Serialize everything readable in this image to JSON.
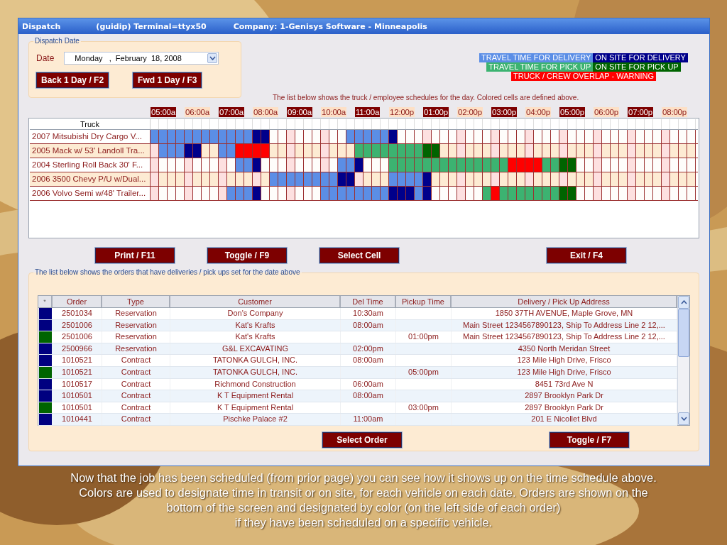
{
  "window": {
    "title_parts": [
      "Dispatch",
      "(guidip) Terminal=ttyx50",
      "Company:  1-Genisys Software - Minneapolis"
    ]
  },
  "dispatch_date": {
    "legend": "Dispatch Date",
    "label": "Date",
    "value": "Monday   ,  February  18, 2008"
  },
  "date_buttons": [
    "Back 1 Day / F2",
    "Fwd 1 Day / F3"
  ],
  "legend": [
    [
      {
        "label": "TRAVEL TIME FOR DELIVERY",
        "kind": "td"
      },
      {
        "label": "ON SITE FOR DELIVERY",
        "kind": "sd"
      }
    ],
    [
      {
        "label": "TRAVEL TIME FOR PICK UP",
        "kind": "tp"
      },
      {
        "label": "ON SITE FOR PICK UP",
        "kind": "sp"
      }
    ],
    [
      {
        "label": "TRUCK / CREW OVERLAP - WARNING",
        "kind": "ov"
      }
    ]
  ],
  "schedule_note": "The list below shows the truck / employee schedules for the day. Colored cells are defined above.",
  "time_labels": [
    "05:00a",
    "06:00a",
    "07:00a",
    "08:00a",
    "09:00a",
    "10:00a",
    "11:00a",
    "12:00p",
    "01:00p",
    "02:00p",
    "03:00p",
    "04:00p",
    "05:00p",
    "06:00p",
    "07:00p",
    "08:00p"
  ],
  "truck_column": "Truck",
  "trucks": [
    {
      "name": "2007 Mitsubishi Dry Cargo V...",
      "slots": [
        {
          "kind": "td"
        },
        {
          "kind": "td"
        },
        {
          "kind": "td"
        },
        {
          "kind": "td"
        },
        {
          "kind": "td"
        },
        {
          "kind": "td"
        },
        {
          "kind": "td"
        },
        {
          "kind": "td"
        },
        {
          "kind": "td"
        },
        {
          "kind": "td"
        },
        {
          "kind": "td"
        },
        {
          "kind": "td"
        },
        {
          "kind": "sd"
        },
        {
          "kind": "sd"
        },
        {
          "kind": "blank"
        },
        {
          "kind": "blank"
        },
        {
          "kind": "blank"
        },
        {
          "kind": "blank"
        },
        {
          "kind": "blank"
        },
        {
          "kind": "blank"
        },
        {
          "kind": "blank"
        },
        {
          "kind": "blank"
        },
        {
          "kind": "blank"
        },
        {
          "kind": "td"
        },
        {
          "kind": "td"
        },
        {
          "kind": "td"
        },
        {
          "kind": "td"
        },
        {
          "kind": "td"
        },
        {
          "kind": "sd"
        },
        {
          "kind": "blank"
        },
        {
          "kind": "blank"
        },
        {
          "kind": "blank"
        },
        {
          "kind": "blank"
        },
        {
          "kind": "blank"
        },
        {
          "kind": "blank"
        },
        {
          "kind": "blank"
        },
        {
          "kind": "blank"
        },
        {
          "kind": "blank"
        },
        {
          "kind": "blank"
        },
        {
          "kind": "blank"
        },
        {
          "kind": "blank"
        },
        {
          "kind": "blank"
        },
        {
          "kind": "blank"
        },
        {
          "kind": "blank"
        },
        {
          "kind": "blank"
        },
        {
          "kind": "blank"
        },
        {
          "kind": "blank"
        },
        {
          "kind": "blank"
        },
        {
          "kind": "blank"
        },
        {
          "kind": "blank"
        },
        {
          "kind": "blank"
        },
        {
          "kind": "blank"
        },
        {
          "kind": "blank"
        },
        {
          "kind": "blank"
        },
        {
          "kind": "blank"
        },
        {
          "kind": "blank"
        },
        {
          "kind": "blank"
        },
        {
          "kind": "blank"
        },
        {
          "kind": "blank"
        },
        {
          "kind": "blank"
        },
        {
          "kind": "blank"
        },
        {
          "kind": "blank"
        },
        {
          "kind": "blank"
        },
        {
          "kind": "blank"
        }
      ]
    },
    {
      "name": "2005 Mack w/ 53' Landoll Tra...",
      "slots": [
        {
          "kind": "blank"
        },
        {
          "kind": "td"
        },
        {
          "kind": "td"
        },
        {
          "kind": "td"
        },
        {
          "kind": "sd"
        },
        {
          "kind": "sd"
        },
        {
          "kind": "blank"
        },
        {
          "kind": "blank"
        },
        {
          "kind": "td"
        },
        {
          "kind": "td"
        },
        {
          "kind": "ov"
        },
        {
          "kind": "ov"
        },
        {
          "kind": "ov"
        },
        {
          "kind": "ov"
        },
        {
          "kind": "blank"
        },
        {
          "kind": "blank"
        },
        {
          "kind": "blank"
        },
        {
          "kind": "blank"
        },
        {
          "kind": "blank"
        },
        {
          "kind": "blank"
        },
        {
          "kind": "blank"
        },
        {
          "kind": "blank"
        },
        {
          "kind": "blank"
        },
        {
          "kind": "blank"
        },
        {
          "kind": "tp"
        },
        {
          "kind": "tp"
        },
        {
          "kind": "tp"
        },
        {
          "kind": "tp"
        },
        {
          "kind": "tp"
        },
        {
          "kind": "tp"
        },
        {
          "kind": "tp"
        },
        {
          "kind": "tp"
        },
        {
          "kind": "sp"
        },
        {
          "kind": "sp"
        },
        {
          "kind": "blank"
        },
        {
          "kind": "blank"
        },
        {
          "kind": "blank"
        },
        {
          "kind": "blank"
        },
        {
          "kind": "blank"
        },
        {
          "kind": "blank"
        },
        {
          "kind": "blank"
        },
        {
          "kind": "blank"
        },
        {
          "kind": "blank"
        },
        {
          "kind": "blank"
        },
        {
          "kind": "blank"
        },
        {
          "kind": "blank"
        },
        {
          "kind": "blank"
        },
        {
          "kind": "blank"
        },
        {
          "kind": "blank"
        },
        {
          "kind": "blank"
        },
        {
          "kind": "blank"
        },
        {
          "kind": "blank"
        },
        {
          "kind": "blank"
        },
        {
          "kind": "blank"
        },
        {
          "kind": "blank"
        },
        {
          "kind": "blank"
        },
        {
          "kind": "blank"
        },
        {
          "kind": "blank"
        },
        {
          "kind": "blank"
        },
        {
          "kind": "blank"
        },
        {
          "kind": "blank"
        },
        {
          "kind": "blank"
        },
        {
          "kind": "blank"
        },
        {
          "kind": "blank"
        }
      ]
    },
    {
      "name": "2004 Sterling Roll Back 30' F...",
      "slots": [
        {
          "kind": "blank"
        },
        {
          "kind": "blank"
        },
        {
          "kind": "blank"
        },
        {
          "kind": "blank"
        },
        {
          "kind": "blank"
        },
        {
          "kind": "blank"
        },
        {
          "kind": "blank"
        },
        {
          "kind": "blank"
        },
        {
          "kind": "blank"
        },
        {
          "kind": "blank"
        },
        {
          "kind": "td"
        },
        {
          "kind": "td"
        },
        {
          "kind": "sd"
        },
        {
          "kind": "blank"
        },
        {
          "kind": "blank"
        },
        {
          "kind": "blank"
        },
        {
          "kind": "blank"
        },
        {
          "kind": "blank"
        },
        {
          "kind": "blank"
        },
        {
          "kind": "blank"
        },
        {
          "kind": "blank"
        },
        {
          "kind": "blank"
        },
        {
          "kind": "td"
        },
        {
          "kind": "td"
        },
        {
          "kind": "sd"
        },
        {
          "kind": "blank"
        },
        {
          "kind": "blank"
        },
        {
          "kind": "blank"
        },
        {
          "kind": "tp"
        },
        {
          "kind": "tp"
        },
        {
          "kind": "tp"
        },
        {
          "kind": "tp"
        },
        {
          "kind": "tp"
        },
        {
          "kind": "tp"
        },
        {
          "kind": "tp"
        },
        {
          "kind": "tp"
        },
        {
          "kind": "tp"
        },
        {
          "kind": "tp"
        },
        {
          "kind": "tp"
        },
        {
          "kind": "tp"
        },
        {
          "kind": "tp"
        },
        {
          "kind": "tp"
        },
        {
          "kind": "ov"
        },
        {
          "kind": "ov"
        },
        {
          "kind": "ov"
        },
        {
          "kind": "ov"
        },
        {
          "kind": "tp"
        },
        {
          "kind": "tp"
        },
        {
          "kind": "sp"
        },
        {
          "kind": "sp"
        },
        {
          "kind": "blank"
        },
        {
          "kind": "blank"
        },
        {
          "kind": "blank"
        },
        {
          "kind": "blank"
        },
        {
          "kind": "blank"
        },
        {
          "kind": "blank"
        },
        {
          "kind": "blank"
        },
        {
          "kind": "blank"
        },
        {
          "kind": "blank"
        },
        {
          "kind": "blank"
        },
        {
          "kind": "blank"
        },
        {
          "kind": "blank"
        },
        {
          "kind": "blank"
        },
        {
          "kind": "blank"
        }
      ]
    },
    {
      "name": "2006 3500 Chevy P/U w/Dual...",
      "slots": [
        {
          "kind": "blank"
        },
        {
          "kind": "blank"
        },
        {
          "kind": "blank"
        },
        {
          "kind": "blank"
        },
        {
          "kind": "blank"
        },
        {
          "kind": "blank"
        },
        {
          "kind": "blank"
        },
        {
          "kind": "blank"
        },
        {
          "kind": "blank"
        },
        {
          "kind": "blank"
        },
        {
          "kind": "blank"
        },
        {
          "kind": "blank"
        },
        {
          "kind": "blank"
        },
        {
          "kind": "blank"
        },
        {
          "kind": "td"
        },
        {
          "kind": "td"
        },
        {
          "kind": "td"
        },
        {
          "kind": "td"
        },
        {
          "kind": "td"
        },
        {
          "kind": "td"
        },
        {
          "kind": "td"
        },
        {
          "kind": "td"
        },
        {
          "kind": "sd"
        },
        {
          "kind": "sd"
        },
        {
          "kind": "blank"
        },
        {
          "kind": "blank"
        },
        {
          "kind": "blank"
        },
        {
          "kind": "blank"
        },
        {
          "kind": "td"
        },
        {
          "kind": "td"
        },
        {
          "kind": "td"
        },
        {
          "kind": "td"
        },
        {
          "kind": "sd"
        },
        {
          "kind": "blank"
        },
        {
          "kind": "blank"
        },
        {
          "kind": "blank"
        },
        {
          "kind": "blank"
        },
        {
          "kind": "blank"
        },
        {
          "kind": "blank"
        },
        {
          "kind": "blank"
        },
        {
          "kind": "blank"
        },
        {
          "kind": "blank"
        },
        {
          "kind": "blank"
        },
        {
          "kind": "blank"
        },
        {
          "kind": "blank"
        },
        {
          "kind": "blank"
        },
        {
          "kind": "blank"
        },
        {
          "kind": "blank"
        },
        {
          "kind": "blank"
        },
        {
          "kind": "blank"
        },
        {
          "kind": "blank"
        },
        {
          "kind": "blank"
        },
        {
          "kind": "blank"
        },
        {
          "kind": "blank"
        },
        {
          "kind": "blank"
        },
        {
          "kind": "blank"
        },
        {
          "kind": "blank"
        },
        {
          "kind": "blank"
        },
        {
          "kind": "blank"
        },
        {
          "kind": "blank"
        },
        {
          "kind": "blank"
        },
        {
          "kind": "blank"
        },
        {
          "kind": "blank"
        },
        {
          "kind": "blank"
        }
      ]
    },
    {
      "name": "2006 Volvo Semi w/48' Trailer...",
      "slots": [
        {
          "kind": "blank"
        },
        {
          "kind": "blank"
        },
        {
          "kind": "blank"
        },
        {
          "kind": "blank"
        },
        {
          "kind": "blank"
        },
        {
          "kind": "blank"
        },
        {
          "kind": "blank"
        },
        {
          "kind": "blank"
        },
        {
          "kind": "blank"
        },
        {
          "kind": "td"
        },
        {
          "kind": "td"
        },
        {
          "kind": "td"
        },
        {
          "kind": "sd"
        },
        {
          "kind": "blank"
        },
        {
          "kind": "blank"
        },
        {
          "kind": "blank"
        },
        {
          "kind": "blank"
        },
        {
          "kind": "blank"
        },
        {
          "kind": "blank"
        },
        {
          "kind": "blank"
        },
        {
          "kind": "td"
        },
        {
          "kind": "td"
        },
        {
          "kind": "td"
        },
        {
          "kind": "td"
        },
        {
          "kind": "td"
        },
        {
          "kind": "td"
        },
        {
          "kind": "td"
        },
        {
          "kind": "td"
        },
        {
          "kind": "sd"
        },
        {
          "kind": "sd"
        },
        {
          "kind": "sd"
        },
        {
          "kind": "td"
        },
        {
          "kind": "sd"
        },
        {
          "kind": "blank"
        },
        {
          "kind": "blank"
        },
        {
          "kind": "blank"
        },
        {
          "kind": "blank"
        },
        {
          "kind": "blank"
        },
        {
          "kind": "blank"
        },
        {
          "kind": "tp"
        },
        {
          "kind": "ov"
        },
        {
          "kind": "tp"
        },
        {
          "kind": "tp"
        },
        {
          "kind": "tp"
        },
        {
          "kind": "tp"
        },
        {
          "kind": "tp"
        },
        {
          "kind": "tp"
        },
        {
          "kind": "tp"
        },
        {
          "kind": "sp"
        },
        {
          "kind": "sp"
        },
        {
          "kind": "blank"
        },
        {
          "kind": "blank"
        },
        {
          "kind": "blank"
        },
        {
          "kind": "blank"
        },
        {
          "kind": "blank"
        },
        {
          "kind": "blank"
        },
        {
          "kind": "blank"
        },
        {
          "kind": "blank"
        },
        {
          "kind": "blank"
        },
        {
          "kind": "blank"
        },
        {
          "kind": "blank"
        },
        {
          "kind": "blank"
        },
        {
          "kind": "blank"
        },
        {
          "kind": "blank"
        }
      ]
    }
  ],
  "schedule_buttons": [
    "Print / F11",
    "Toggle / F9",
    "Select Cell",
    "Exit / F4"
  ],
  "orders": {
    "legend": "The list below shows the orders that have deliveries / pick ups set for the date above",
    "marker_column": "*",
    "columns": [
      "Order",
      "Type",
      "Customer",
      "Del Time",
      "Pickup Time",
      "Delivery / Pick Up Address"
    ],
    "rows": [
      {
        "color": "#000080",
        "cells": [
          "2501034",
          "Reservation",
          "Don's Company",
          "10:30am",
          "",
          "1850 37TH AVENUE, Maple Grove, MN"
        ]
      },
      {
        "color": "#000080",
        "cells": [
          "2501006",
          "Reservation",
          "Kat's Krafts",
          "08:00am",
          "",
          "Main Street 1234567890123, Ship To Address Line 2 12,..."
        ]
      },
      {
        "color": "#006400",
        "cells": [
          "2501006",
          "Reservation",
          "Kat's Krafts",
          "",
          "01:00pm",
          "Main Street 1234567890123, Ship To Address Line 2 12,..."
        ]
      },
      {
        "color": "#000080",
        "cells": [
          "2500966",
          "Reservation",
          "G&L EXCAVATING",
          "02:00pm",
          "",
          "4350 North Meridan Street"
        ]
      },
      {
        "color": "#000080",
        "cells": [
          "1010521",
          "Contract",
          "TATONKA GULCH, INC.",
          "08:00am",
          "",
          "123 Mile High Drive, Frisco"
        ]
      },
      {
        "color": "#006400",
        "cells": [
          "1010521",
          "Contract",
          "TATONKA GULCH, INC.",
          "",
          "05:00pm",
          "123 Mile High Drive, Frisco"
        ]
      },
      {
        "color": "#000080",
        "cells": [
          "1010517",
          "Contract",
          "Richmond Construction",
          "06:00am",
          "",
          "8451 73rd Ave N"
        ]
      },
      {
        "color": "#000080",
        "cells": [
          "1010501",
          "Contract",
          "K T Equipment Rental",
          "08:00am",
          "",
          "2897 Brooklyn Park Dr"
        ]
      },
      {
        "color": "#006400",
        "cells": [
          "1010501",
          "Contract",
          "K T Equipment Rental",
          "",
          "03:00pm",
          "2897 Brooklyn Park Dr"
        ]
      },
      {
        "color": "#000080",
        "cells": [
          "1010441",
          "Contract",
          "Pischke Palace #2",
          "11:00am",
          "",
          "201 E Nicollet Blvd"
        ]
      }
    ]
  },
  "order_buttons": [
    "Select Order",
    "Toggle / F7"
  ],
  "caption_lines": [
    "Now that the job has been scheduled (from prior page) you can see how it shows up on the time schedule above.",
    "Colors are used to designate time in transit or on site, for each vehicle on each date. Orders are shown on the",
    "bottom of the screen and designated by color (on the left side of each order)",
    "if they have been scheduled on a specific vehicle."
  ]
}
